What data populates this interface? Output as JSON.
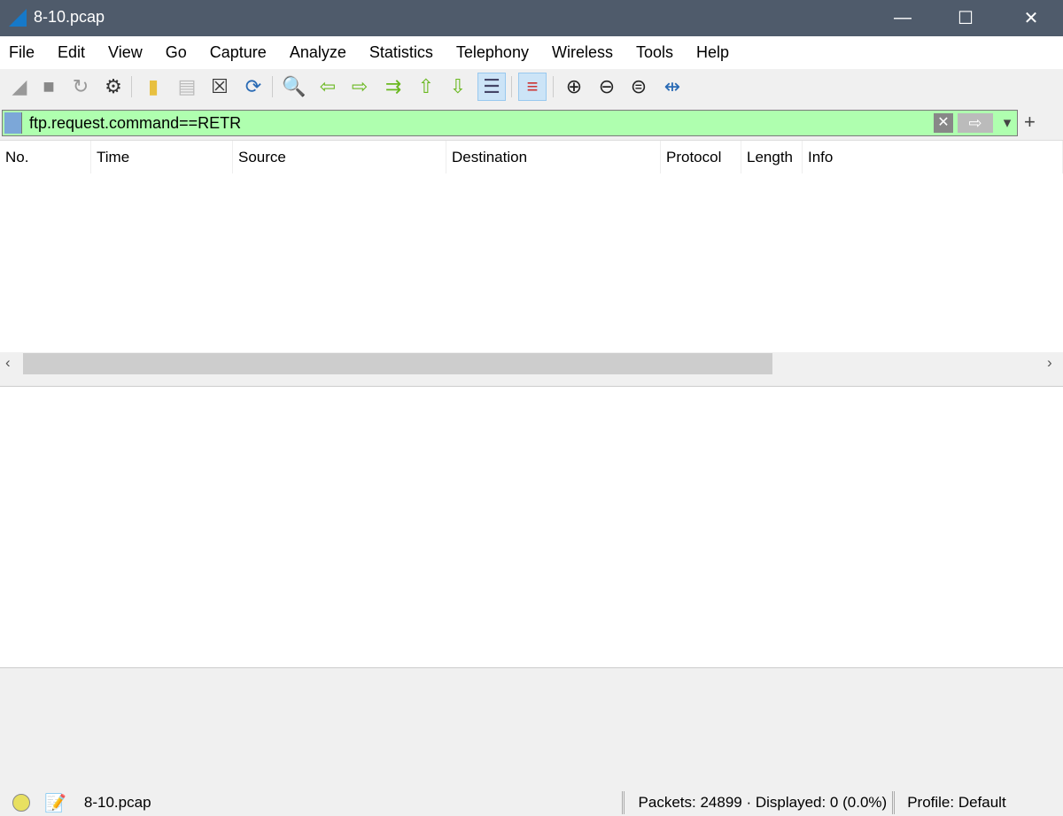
{
  "window": {
    "title": "8-10.pcap",
    "minimize": "—",
    "maximize": "☐",
    "close": "✕"
  },
  "menu": [
    "File",
    "Edit",
    "View",
    "Go",
    "Capture",
    "Analyze",
    "Statistics",
    "Telephony",
    "Wireless",
    "Tools",
    "Help"
  ],
  "toolbar": [
    {
      "name": "start-capture-icon",
      "glyph": "◢"
    },
    {
      "name": "stop-capture-icon",
      "glyph": "■"
    },
    {
      "name": "restart-capture-icon",
      "glyph": "↻"
    },
    {
      "name": "capture-options-icon",
      "glyph": "⚙"
    },
    {
      "name": "open-file-icon",
      "glyph": "▮"
    },
    {
      "name": "save-file-icon",
      "glyph": "▤"
    },
    {
      "name": "close-file-icon",
      "glyph": "☒"
    },
    {
      "name": "reload-file-icon",
      "glyph": "⟳"
    },
    {
      "name": "find-packet-icon",
      "glyph": "🔍"
    },
    {
      "name": "go-back-icon",
      "glyph": "⇦"
    },
    {
      "name": "go-forward-icon",
      "glyph": "⇨"
    },
    {
      "name": "go-to-packet-icon",
      "glyph": "⇉"
    },
    {
      "name": "first-packet-icon",
      "glyph": "⇧"
    },
    {
      "name": "last-packet-icon",
      "glyph": "⇩"
    },
    {
      "name": "autoscroll-icon",
      "glyph": "☰",
      "active": true
    },
    {
      "name": "colorize-icon",
      "glyph": "≡",
      "active": true
    },
    {
      "name": "zoom-in-icon",
      "glyph": "⊕"
    },
    {
      "name": "zoom-out-icon",
      "glyph": "⊖"
    },
    {
      "name": "normal-size-icon",
      "glyph": "⊜"
    },
    {
      "name": "resize-columns-icon",
      "glyph": "⇹"
    }
  ],
  "filter": {
    "value": "ftp.request.command==RETR",
    "clear": "✕",
    "apply": "⇨",
    "dropdown": "▾",
    "add": "+",
    "bg_color": "#afffaf"
  },
  "columns": [
    "No.",
    "Time",
    "Source",
    "Destination",
    "Protocol",
    "Length",
    "Info"
  ],
  "scroll": {
    "left": "‹",
    "right": "›"
  },
  "status": {
    "file": "8-10.pcap",
    "packets": "Packets: 24899 · Displayed: 0 (0.0%)",
    "profile": "Profile: Default"
  }
}
